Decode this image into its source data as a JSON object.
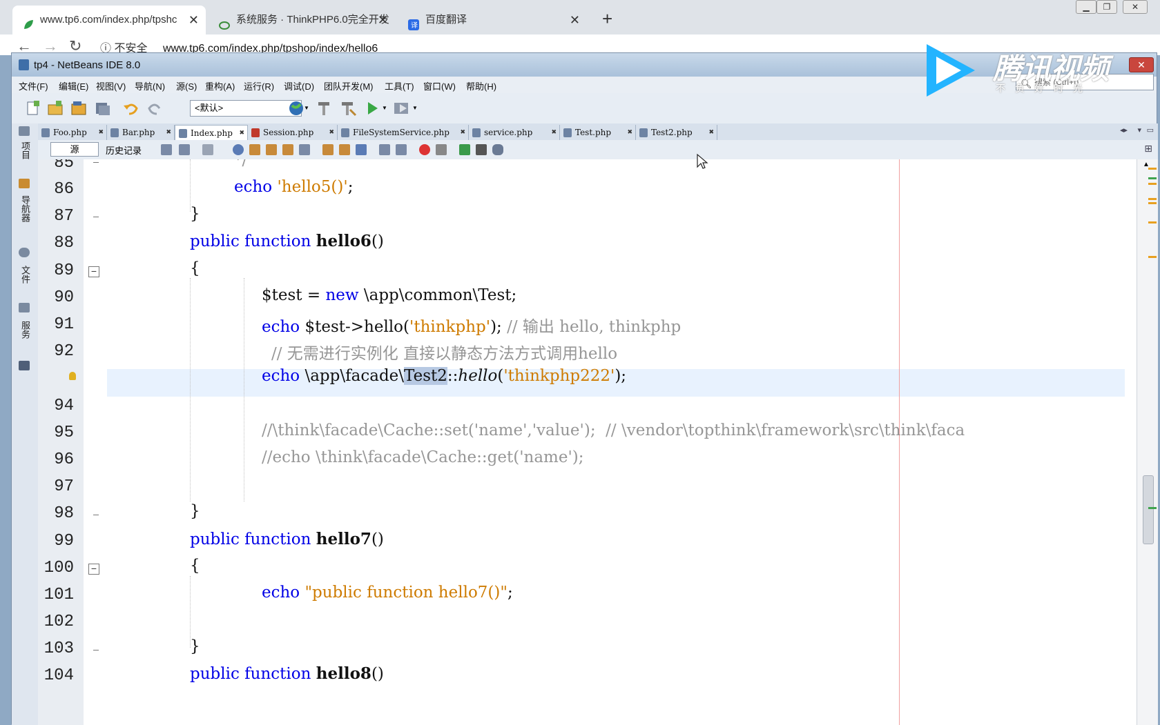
{
  "browser": {
    "tabs": [
      {
        "label": "www.tp6.com/index.php/tpshc",
        "active": true
      },
      {
        "label": "系统服务 · ThinkPHP6.0完全开发",
        "active": false
      },
      {
        "label": "百度翻译",
        "active": false
      }
    ],
    "new_tab": "+",
    "security": "不安全",
    "url": "www.tp6.com/index.php/tpshop/index/hello6"
  },
  "watermark": {
    "brand": "腾讯视频",
    "slogan": "不负好时光"
  },
  "ide": {
    "title": "tp4 - NetBeans IDE 8.0",
    "menu": [
      "文件(F)",
      "编辑(E)",
      "视图(V)",
      "导航(N)",
      "源(S)",
      "重构(A)",
      "运行(R)",
      "调试(D)",
      "团队开发(M)",
      "工具(T)",
      "窗口(W)",
      "帮助(H)"
    ],
    "config_select": "<默认>",
    "search_placeholder": "搜索 (Ctrl+I)",
    "side_panels": [
      "项目",
      "导航器",
      "文件",
      "服务"
    ],
    "file_tabs": [
      "Foo.php",
      "Bar.php",
      "Index.php",
      "Session.php",
      "FileSystemService.php",
      "service.php",
      "Test.php",
      "Test2.php"
    ],
    "active_tab_index": 2,
    "editor_tabs": {
      "source": "源",
      "history": "历史记录"
    },
    "line_numbers": [
      "85",
      "86",
      "87",
      "88",
      "89",
      "90",
      "91",
      "92",
      "",
      "94",
      "95",
      "96",
      "97",
      "98",
      "99",
      "100",
      "101",
      "102",
      "103",
      "104"
    ],
    "code": {
      "l85": "*/",
      "l86_kw": "echo",
      "l86_str": "'hello5()'",
      "l86_end": ";",
      "l87": "}",
      "l88_kw": "public function",
      "l88_fn": "hello6",
      "l88_end": "()",
      "l89": "{",
      "l90_var": "$test = ",
      "l90_kw": "new",
      "l90_rest": " \\app\\common\\Test;",
      "l91_kw": "echo",
      "l91_mid": " $test->hello(",
      "l91_str": "'thinkphp'",
      "l91_end": ");",
      "l91_cm": " // 输出 hello, thinkphp",
      "l92_cm": "// 无需进行实例化 直接以静态方法方式调用hello",
      "l93_kw": "echo",
      "l93_a": " \\app\\facade\\",
      "l93_sel": "Test2",
      "l93_b": "::",
      "l93_it": "hello",
      "l93_c": "(",
      "l93_str": "'thinkphp222'",
      "l93_end": ");",
      "l95_cm": "//\\think\\facade\\Cache::set('name','value');  // \\vendor\\topthink\\framework\\src\\think\\faca",
      "l96_cm": "//echo \\think\\facade\\Cache::get('name');",
      "l98": "}",
      "l99_kw": "public function",
      "l99_fn": "hello7",
      "l99_end": "()",
      "l100": "{",
      "l101_kw": "echo",
      "l101_str": "\"public function hello7()\"",
      "l101_end": ";",
      "l103": "}",
      "l104_kw": "public function",
      "l104_fn": "hello8",
      "l104_end": "()"
    }
  }
}
